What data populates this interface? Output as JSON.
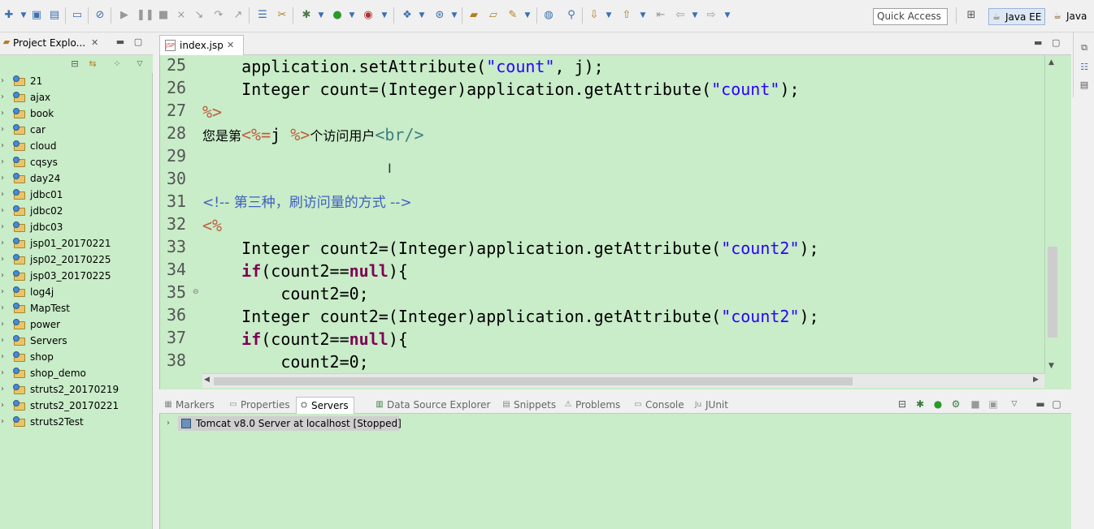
{
  "toolbar": {
    "quick_access": "Quick Access",
    "perspectives": [
      {
        "label": "Java EE",
        "active": true
      },
      {
        "label": "Java",
        "active": false
      }
    ]
  },
  "explorer": {
    "title": "Project Explo...",
    "projects": [
      "21",
      "ajax",
      "book",
      "car",
      "cloud",
      "cqsys",
      "day24",
      "jdbc01",
      "jdbc02",
      "jdbc03",
      "jsp01_20170221",
      "jsp02_20170225",
      "jsp03_20170225",
      "log4j",
      "MapTest",
      "power",
      "Servers",
      "shop",
      "shop_demo",
      "struts2_20170219",
      "struts2_20170221",
      "struts2Test"
    ]
  },
  "editor": {
    "tab_label": "index.jsp",
    "line_numbers": [
      "25",
      "26",
      "27",
      "28",
      "29",
      "30",
      "31",
      "32",
      "33",
      "34",
      "35",
      "36",
      "37",
      "38"
    ],
    "lines": {
      "l25a": "    application.setAttribute(",
      "l25b": "\"count\"",
      "l25c": ", j);",
      "l26a": "    Integer count=(Integer)application.getAttribute(",
      "l26b": "\"count\"",
      "l26c": ");",
      "l27a": "%>",
      "l28a": "您是第",
      "l28b": "<%=",
      "l28c": "j ",
      "l28d": "%>",
      "l28e": "个访问用户",
      "l28f": "<br/>",
      "l31a": "<!-- 第三种，刷访问量的方式 -->",
      "l32a": "<%",
      "l33a": "    Integer count2=(Integer)application.getAttribute(",
      "l33b": "\"count2\"",
      "l33c": ");",
      "l34a": "    ",
      "l34b": "if",
      "l34c": "(count2==",
      "l34d": "null",
      "l34e": "){",
      "l35a": "        count2=0;",
      "l36a": "    Integer count2=(Integer)application.getAttribute(",
      "l36b": "\"count2\"",
      "l36c": ");",
      "l37a": "    ",
      "l37b": "if",
      "l37c": "(count2==",
      "l37d": "null",
      "l37e": "){",
      "l38a": "        count2=0;"
    }
  },
  "bottom": {
    "tabs": [
      {
        "label": "Markers",
        "icon": "markers-icon"
      },
      {
        "label": "Properties",
        "icon": "properties-icon"
      },
      {
        "label": "Servers",
        "icon": "servers-icon",
        "active": true
      },
      {
        "label": "Data Source Explorer",
        "icon": "datasource-icon"
      },
      {
        "label": "Snippets",
        "icon": "snippets-icon"
      },
      {
        "label": "Problems",
        "icon": "problems-icon"
      },
      {
        "label": "Console",
        "icon": "console-icon"
      },
      {
        "label": "JUnit",
        "icon": "junit-icon"
      }
    ],
    "server": "Tomcat v8.0 Server at localhost  [Stopped]"
  },
  "colors": {
    "editor_bg": "#c9ecc9",
    "string": "#2a00ff",
    "keyword": "#7f0055",
    "jsp_tag": "#bf5f3f",
    "html_tag": "#3f7f7f",
    "comment": "#3f5fbf"
  }
}
